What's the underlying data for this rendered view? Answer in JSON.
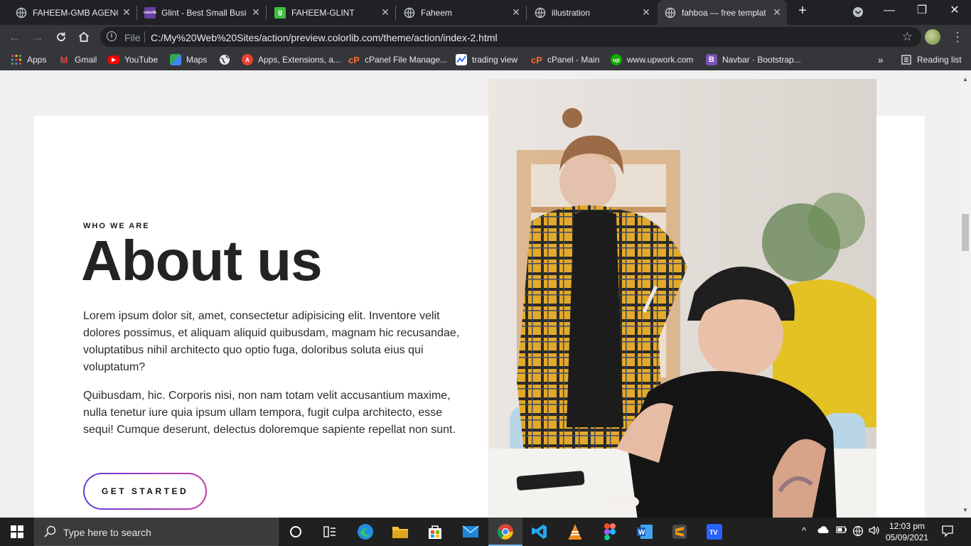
{
  "browser": {
    "tabs": [
      {
        "title": "FAHEEM-GMB AGENCY",
        "favicon": "globe-icon"
      },
      {
        "title": "Glint - Best Small Business",
        "favicon": "colorlib-icon"
      },
      {
        "title": "FAHEEM-GLINT",
        "favicon": "g-icon"
      },
      {
        "title": "Faheem",
        "favicon": "globe-icon"
      },
      {
        "title": "illustration",
        "favicon": "globe-icon"
      },
      {
        "title": "fahboa — free template",
        "favicon": "globe-icon"
      }
    ],
    "new_tab_symbol": "+",
    "address": {
      "scheme_label": "File",
      "url": "C:/My%20Web%20Sites/action/preview.colorlib.com/theme/action/index-2.html"
    },
    "bookmarks": [
      {
        "label": "Apps",
        "icon": "apps-grid-icon",
        "color": "#ea4335"
      },
      {
        "label": "Gmail",
        "icon": "gmail-icon",
        "color": "#ea4335"
      },
      {
        "label": "YouTube",
        "icon": "youtube-icon",
        "color": "#ff0000"
      },
      {
        "label": "Maps",
        "icon": "maps-icon",
        "color": "#34a853"
      },
      {
        "label": "",
        "icon": "globe-icon",
        "color": "#e8eaed"
      },
      {
        "label": "Apps, Extensions, a...",
        "icon": "web-store-icon",
        "color": "#e94335"
      },
      {
        "label": "cPanel File Manage...",
        "icon": "cpanel-icon",
        "color": "#ff6c2c"
      },
      {
        "label": "trading view",
        "icon": "tradingview-icon",
        "color": "#2962ff"
      },
      {
        "label": "cPanel - Main",
        "icon": "cpanel-icon",
        "color": "#ff6c2c"
      },
      {
        "label": "www.upwork.com",
        "icon": "upwork-icon",
        "color": "#14a800"
      },
      {
        "label": "Navbar · Bootstrap...",
        "icon": "bootstrap-icon",
        "color": "#7952b3"
      }
    ],
    "overflow_label": "»",
    "reading_list_label": "Reading list"
  },
  "page": {
    "eyebrow": "WHO WE ARE",
    "heading": "About us",
    "paragraph_1": "Lorem ipsum dolor sit, amet, consectetur adipisicing elit. Inventore velit dolores possimus, et aliquam aliquid quibusdam, magnam hic recusandae, voluptatibus nihil architecto quo optio fuga, doloribus soluta eius qui voluptatum?",
    "paragraph_2": "Quibusdam, hic. Corporis nisi, non nam totam velit accusantium maxime, nulla tenetur iure quia ipsum ullam tempora, fugit culpa architecto, esse sequi! Cumque deserunt, delectus doloremque sapiente repellat non sunt.",
    "cta_label": "GET STARTED",
    "photo_subject": "two-people-office-photo"
  },
  "colors": {
    "cta_gradient_start": "#6a3fd6",
    "cta_gradient_end": "#c63aa8",
    "page_background": "#f0f0f0",
    "card_background": "#ffffff"
  },
  "taskbar": {
    "search_placeholder": "Type here to search",
    "apps": [
      "task-view-icon",
      "widgets-icon",
      "edge-icon",
      "file-explorer-icon",
      "store-icon",
      "mail-icon",
      "chrome-icon",
      "vscode-icon",
      "vlc-icon",
      "figma-icon",
      "word-icon",
      "sublime-icon",
      "tradingview-icon"
    ],
    "time": "12:03 pm",
    "date": "05/09/2021"
  }
}
